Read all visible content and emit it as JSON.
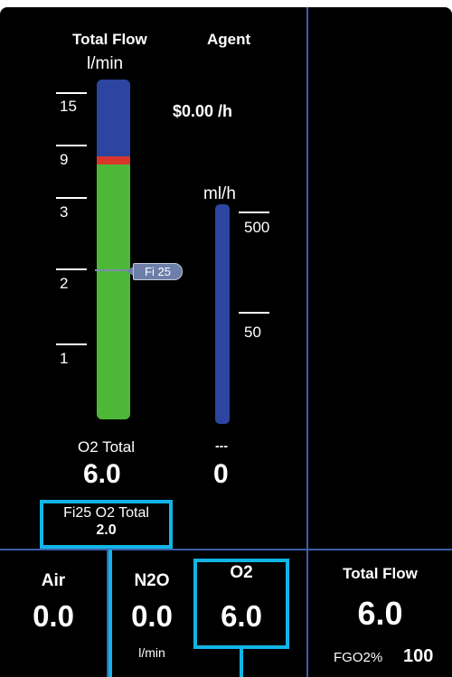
{
  "flow_header": "Total Flow",
  "flow_unit": "l/min",
  "agent_header": "Agent",
  "cost": "$0.00 /h",
  "agent_unit": "ml/h",
  "flow_scale": [
    "15",
    "9",
    "3",
    "2",
    "1"
  ],
  "agent_scale": [
    "500",
    "50"
  ],
  "fi_tag": "Fi 25",
  "o2_total_label": "O2 Total",
  "o2_total_value": "6.0",
  "agent_rate_label": "---",
  "agent_rate_value": "0",
  "fi25_label": "Fi25 O2 Total",
  "fi25_value": "2.0",
  "gases": {
    "air": {
      "label": "Air",
      "value": "0.0"
    },
    "n2o": {
      "label": "N2O",
      "value": "0.0",
      "unit": "l/min"
    },
    "o2": {
      "label": "O2",
      "value": "6.0"
    }
  },
  "total_flow": {
    "label": "Total Flow",
    "value": "6.0",
    "fgo2_label": "FGO2%",
    "fgo2_value": "100"
  },
  "colors": {
    "flow_fill": "#4db838",
    "bar_empty": "#2b45a0",
    "highlight": "#12b4e6",
    "divider": "#3d5fa8"
  }
}
